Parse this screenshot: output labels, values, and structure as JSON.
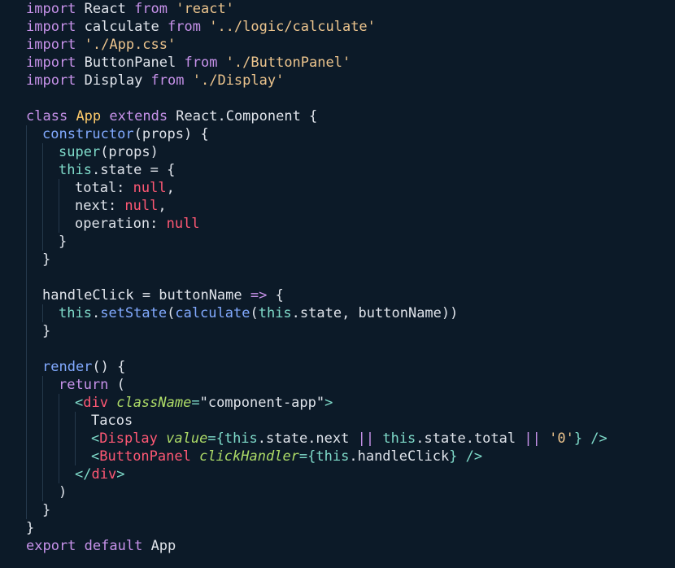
{
  "theme": {
    "background": "#0c1a28",
    "indent_guide": "#25394c",
    "token_colors": {
      "plain": "#dfe3ea",
      "keyword": "#c792ea",
      "string": "#ecc48d",
      "className": "#ffcb6b",
      "func": "#82aaff",
      "thisKw": "#7fdbca",
      "null": "#ff5874",
      "punct": "#c792ea",
      "tag": "#ff5874",
      "tagPunct": "#7fdbca",
      "attr": "#addb67",
      "text": "#dfe3ea"
    }
  },
  "editor": {
    "language": "javascript",
    "lines": [
      {
        "indent": 0,
        "tokens": [
          {
            "t": "import",
            "k": "keyword"
          },
          {
            "t": " React ",
            "k": "plain"
          },
          {
            "t": "from",
            "k": "keyword"
          },
          {
            "t": " 'react'",
            "k": "string"
          }
        ]
      },
      {
        "indent": 0,
        "tokens": [
          {
            "t": "import",
            "k": "keyword"
          },
          {
            "t": " calculate ",
            "k": "plain"
          },
          {
            "t": "from",
            "k": "keyword"
          },
          {
            "t": " '../logic/calculate'",
            "k": "string"
          }
        ]
      },
      {
        "indent": 0,
        "tokens": [
          {
            "t": "import",
            "k": "keyword"
          },
          {
            "t": " './App.css'",
            "k": "string"
          }
        ]
      },
      {
        "indent": 0,
        "tokens": [
          {
            "t": "import",
            "k": "keyword"
          },
          {
            "t": " ButtonPanel ",
            "k": "plain"
          },
          {
            "t": "from",
            "k": "keyword"
          },
          {
            "t": " './ButtonPanel'",
            "k": "string"
          }
        ]
      },
      {
        "indent": 0,
        "tokens": [
          {
            "t": "import",
            "k": "keyword"
          },
          {
            "t": " Display ",
            "k": "plain"
          },
          {
            "t": "from",
            "k": "keyword"
          },
          {
            "t": " './Display'",
            "k": "string"
          }
        ]
      },
      {
        "indent": 0,
        "tokens": []
      },
      {
        "indent": 0,
        "tokens": [
          {
            "t": "class",
            "k": "keyword"
          },
          {
            "t": " ",
            "k": "plain"
          },
          {
            "t": "App",
            "k": "className"
          },
          {
            "t": " ",
            "k": "plain"
          },
          {
            "t": "extends",
            "k": "keyword"
          },
          {
            "t": " React.Component {",
            "k": "plain"
          }
        ]
      },
      {
        "indent": 1,
        "tokens": [
          {
            "t": "constructor",
            "k": "func"
          },
          {
            "t": "(props) {",
            "k": "plain"
          }
        ]
      },
      {
        "indent": 2,
        "tokens": [
          {
            "t": "super",
            "k": "thisKw"
          },
          {
            "t": "(props)",
            "k": "plain"
          }
        ]
      },
      {
        "indent": 2,
        "tokens": [
          {
            "t": "this",
            "k": "thisKw"
          },
          {
            "t": ".state = {",
            "k": "plain"
          }
        ]
      },
      {
        "indent": 3,
        "tokens": [
          {
            "t": "total: ",
            "k": "plain"
          },
          {
            "t": "null",
            "k": "null"
          },
          {
            "t": ",",
            "k": "plain"
          }
        ]
      },
      {
        "indent": 3,
        "tokens": [
          {
            "t": "next: ",
            "k": "plain"
          },
          {
            "t": "null",
            "k": "null"
          },
          {
            "t": ",",
            "k": "plain"
          }
        ]
      },
      {
        "indent": 3,
        "tokens": [
          {
            "t": "operation: ",
            "k": "plain"
          },
          {
            "t": "null",
            "k": "null"
          }
        ]
      },
      {
        "indent": 2,
        "tokens": [
          {
            "t": "}",
            "k": "plain"
          }
        ]
      },
      {
        "indent": 1,
        "tokens": [
          {
            "t": "}",
            "k": "plain"
          }
        ]
      },
      {
        "indent": 1,
        "tokens": []
      },
      {
        "indent": 1,
        "tokens": [
          {
            "t": "handleClick = buttonName ",
            "k": "plain"
          },
          {
            "t": "=>",
            "k": "punct"
          },
          {
            "t": " {",
            "k": "plain"
          }
        ]
      },
      {
        "indent": 2,
        "tokens": [
          {
            "t": "this",
            "k": "thisKw"
          },
          {
            "t": ".",
            "k": "plain"
          },
          {
            "t": "setState",
            "k": "func"
          },
          {
            "t": "(",
            "k": "plain"
          },
          {
            "t": "calculate",
            "k": "func"
          },
          {
            "t": "(",
            "k": "plain"
          },
          {
            "t": "this",
            "k": "thisKw"
          },
          {
            "t": ".state, buttonName))",
            "k": "plain"
          }
        ]
      },
      {
        "indent": 1,
        "tokens": [
          {
            "t": "}",
            "k": "plain"
          }
        ]
      },
      {
        "indent": 1,
        "tokens": []
      },
      {
        "indent": 1,
        "tokens": [
          {
            "t": "render",
            "k": "func"
          },
          {
            "t": "() {",
            "k": "plain"
          }
        ]
      },
      {
        "indent": 2,
        "tokens": [
          {
            "t": "return",
            "k": "keyword"
          },
          {
            "t": " (",
            "k": "plain"
          }
        ]
      },
      {
        "indent": 3,
        "tokens": [
          {
            "t": "<",
            "k": "tagPunct"
          },
          {
            "t": "div",
            "k": "tag"
          },
          {
            "t": " ",
            "k": "plain"
          },
          {
            "t": "className",
            "k": "attr"
          },
          {
            "t": "=",
            "k": "tagPunct"
          },
          {
            "t": "\"component-app\"",
            "k": "plain"
          },
          {
            "t": ">",
            "k": "tagPunct"
          }
        ]
      },
      {
        "indent": 4,
        "tokens": [
          {
            "t": "Tacos",
            "k": "text"
          }
        ]
      },
      {
        "indent": 4,
        "tokens": [
          {
            "t": "<",
            "k": "tagPunct"
          },
          {
            "t": "Display",
            "k": "tag"
          },
          {
            "t": " ",
            "k": "plain"
          },
          {
            "t": "value",
            "k": "attr"
          },
          {
            "t": "={",
            "k": "tagPunct"
          },
          {
            "t": "this",
            "k": "thisKw"
          },
          {
            "t": ".state.next ",
            "k": "plain"
          },
          {
            "t": "||",
            "k": "punct"
          },
          {
            "t": " ",
            "k": "plain"
          },
          {
            "t": "this",
            "k": "thisKw"
          },
          {
            "t": ".state.total ",
            "k": "plain"
          },
          {
            "t": "||",
            "k": "punct"
          },
          {
            "t": " ",
            "k": "plain"
          },
          {
            "t": "'0'",
            "k": "string"
          },
          {
            "t": "}",
            "k": "tagPunct"
          },
          {
            "t": " />",
            "k": "tagPunct"
          }
        ]
      },
      {
        "indent": 4,
        "tokens": [
          {
            "t": "<",
            "k": "tagPunct"
          },
          {
            "t": "ButtonPanel",
            "k": "tag"
          },
          {
            "t": " ",
            "k": "plain"
          },
          {
            "t": "clickHandler",
            "k": "attr"
          },
          {
            "t": "={",
            "k": "tagPunct"
          },
          {
            "t": "this",
            "k": "thisKw"
          },
          {
            "t": ".handleClick",
            "k": "plain"
          },
          {
            "t": "}",
            "k": "tagPunct"
          },
          {
            "t": " />",
            "k": "tagPunct"
          }
        ]
      },
      {
        "indent": 3,
        "tokens": [
          {
            "t": "</",
            "k": "tagPunct"
          },
          {
            "t": "div",
            "k": "tag"
          },
          {
            "t": ">",
            "k": "tagPunct"
          }
        ]
      },
      {
        "indent": 2,
        "tokens": [
          {
            "t": ")",
            "k": "plain"
          }
        ]
      },
      {
        "indent": 1,
        "tokens": [
          {
            "t": "}",
            "k": "plain"
          }
        ]
      },
      {
        "indent": 0,
        "tokens": [
          {
            "t": "}",
            "k": "plain"
          }
        ]
      },
      {
        "indent": 0,
        "tokens": [
          {
            "t": "export",
            "k": "keyword"
          },
          {
            "t": " ",
            "k": "plain"
          },
          {
            "t": "default",
            "k": "keyword"
          },
          {
            "t": " App",
            "k": "plain"
          }
        ]
      }
    ]
  }
}
